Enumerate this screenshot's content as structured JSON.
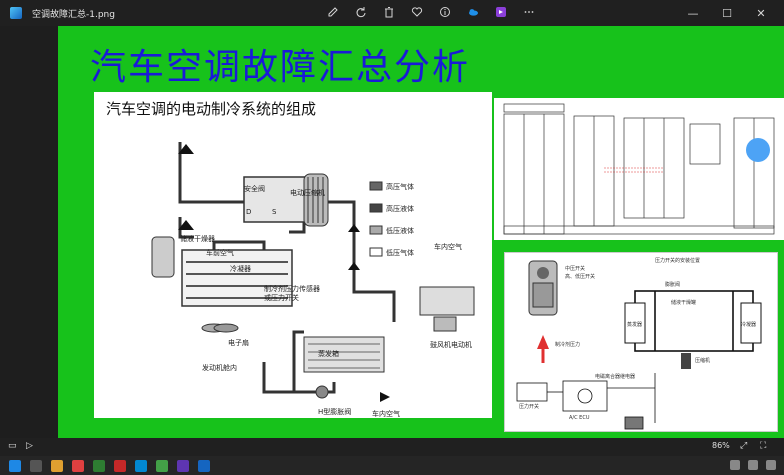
{
  "window": {
    "title": "空调故障汇总-1.png"
  },
  "toolbar": {
    "buttons": [
      "edit-icon",
      "rotate-icon",
      "delete-icon",
      "favorite-icon",
      "info-icon",
      "onedrive-icon",
      "clipchamp-icon",
      "more-icon"
    ]
  },
  "window_controls": {
    "minimize": "—",
    "maximize": "☐",
    "close": "✕"
  },
  "slide": {
    "title": "汽车空调故障汇总分析",
    "main_panel_title": "汽车空调的电动制冷系统的组成",
    "labels": {
      "safety_valve": "安全阀",
      "compressor": "电动压缩机",
      "receiver_drier": "储液干燥器",
      "front_air": "车前空气",
      "condenser": "冷凝器",
      "pressure_sensor_1": "制冷剂压力传感器",
      "pressure_sensor_2": "或压力开关",
      "electric_fan": "电子扇",
      "engine_bay": "发动机舱内",
      "evaporator": "蒸发箱",
      "blower_motor": "鼓风机电动机",
      "cabin_air_top": "车内空气",
      "expansion_valve": "H型膨胀阀",
      "cabin_air_bottom": "车内空气",
      "port_d": "D",
      "port_s": "S"
    },
    "legend": [
      {
        "label": "高压气体",
        "color": "#666666"
      },
      {
        "label": "高压液体",
        "color": "#444444"
      },
      {
        "label": "低压液体",
        "color": "#aaaaaa"
      },
      {
        "label": "低压气体",
        "color": "#ffffff"
      }
    ],
    "sensor_panel": {
      "top_label": "压力开关的安装位置",
      "left_label_1": "中压开关",
      "left_label_2": "高、低压开关",
      "pressure_label": "制冷剂压力",
      "expansion_valve": "膨胀阀",
      "receiver": "储液干燥罐",
      "evaporator": "蒸发器",
      "condenser": "冷凝器",
      "compressor": "压缩机",
      "clutch_relay": "电磁离合器继电器",
      "pressure_switch": "压力开关",
      "ecu": "A/C ECU"
    }
  },
  "status": {
    "zoom": "86%"
  }
}
